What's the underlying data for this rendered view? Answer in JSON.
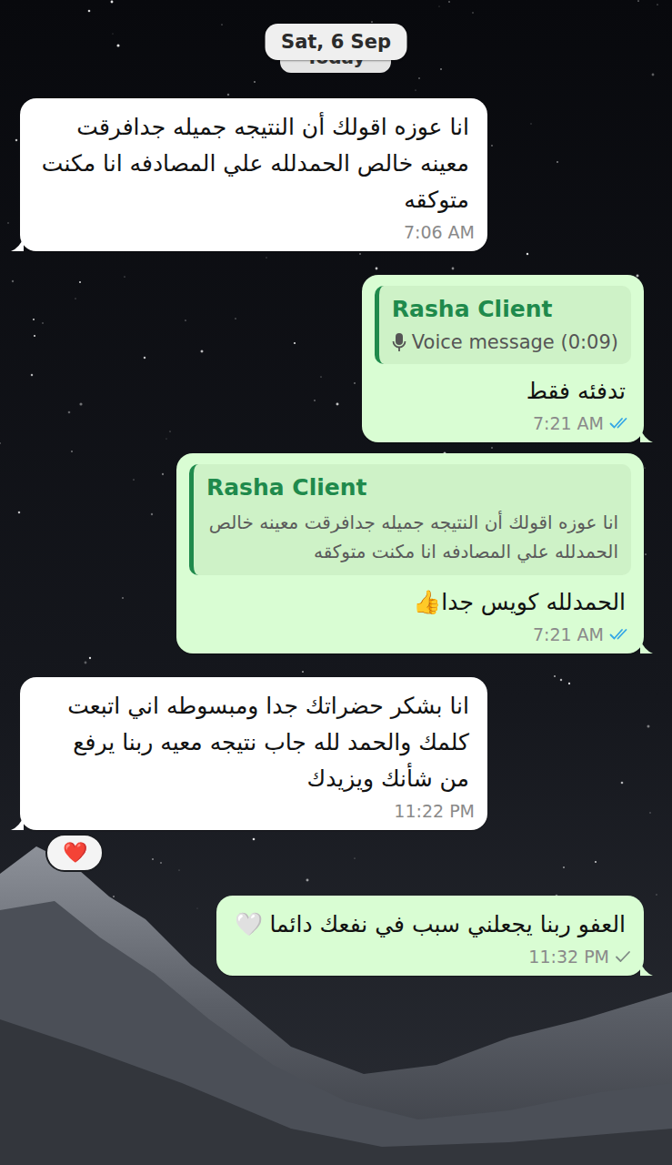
{
  "header": {
    "date": "Sat, 6 Sep",
    "behind_date": "Today"
  },
  "messages": [
    {
      "kind": "incoming",
      "text": "انا عوزه اقولك أن النتيجه جميله جدافرقت معينه خالص الحمدلله علي المصادفه انا مكنت متوكقه",
      "time": "7:06 AM"
    },
    {
      "kind": "outgoing",
      "quote": {
        "kind": "voice",
        "author": "Rasha Client",
        "text": "Voice message (0:09)"
      },
      "text": "تدفئه فقط",
      "time": "7:21 AM",
      "delivered": true,
      "read": true
    },
    {
      "kind": "outgoing",
      "quote": {
        "kind": "text",
        "author": "Rasha Client",
        "text": "انا عوزه اقولك أن النتيجه جميله جدافرقت معينه خالص الحمدلله علي المصادفه انا مكنت متوكقه"
      },
      "text": "الحمدلله كويس جدا👍",
      "time": "7:21 AM",
      "delivered": true,
      "read": true
    },
    {
      "kind": "incoming",
      "text": "انا بشكر حضراتك جدا ومبسوطه اني اتبعت كلمك والحمد لله جاب نتيجه معيه ربنا يرفع من شأنك ويزيدك",
      "time": "11:22 PM",
      "reaction": "❤️"
    },
    {
      "kind": "outgoing",
      "text": "العفو ربنا يجعلني سبب في نفعك دائما 🤍",
      "time": "11:32 PM",
      "delivered": false,
      "read": false
    }
  ]
}
